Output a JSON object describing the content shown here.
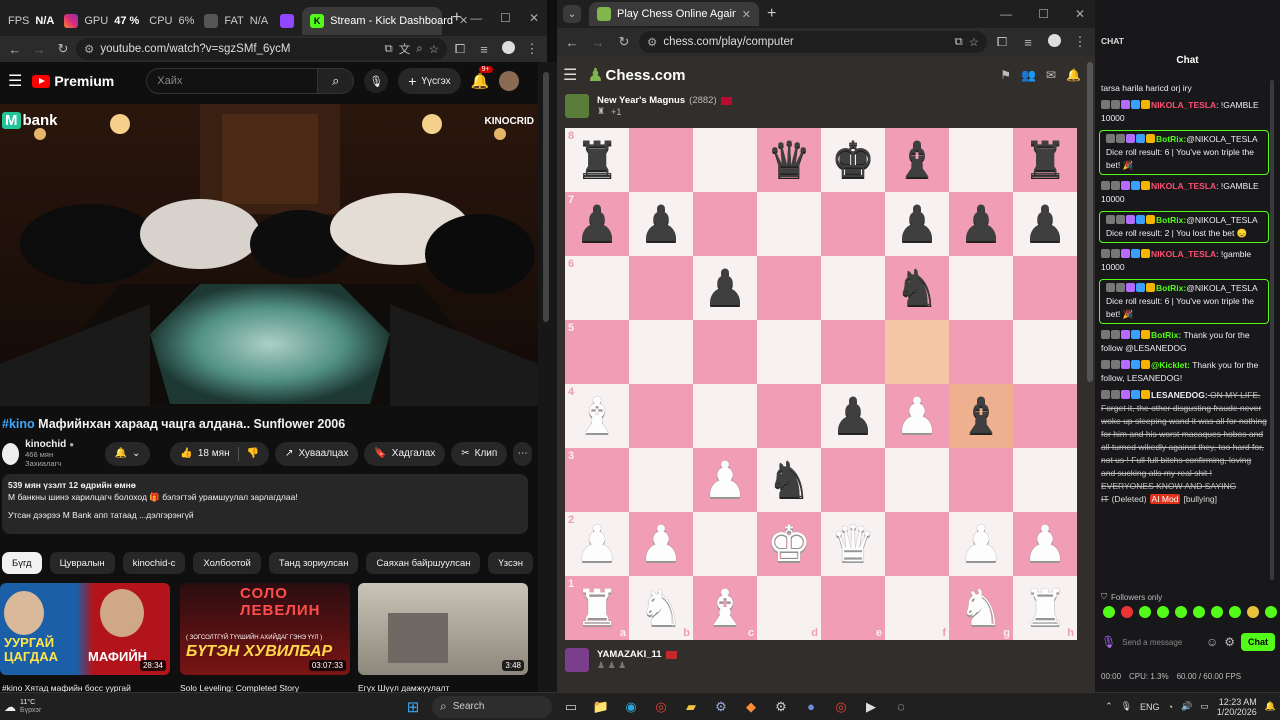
{
  "left_browser": {
    "tabs": [
      {
        "label": "FPS",
        "stat": "N/A"
      },
      {
        "label": "GPU",
        "stat": "47 %"
      },
      {
        "label": "CPU",
        "stat": "6%"
      },
      {
        "label": "FAT",
        "stat": "N/A"
      },
      {
        "label": ""
      },
      {
        "label": "Stream - Kick Dashboard"
      }
    ],
    "url": "youtube.com/watch?v=sgzSMf_6ycM"
  },
  "youtube": {
    "brand": "Premium",
    "search_placeholder": "Хайх",
    "create_label": "Үүсгэх",
    "notif_count": "9+",
    "video_overlay_left": "bank",
    "video_overlay_left_prefix": "M",
    "video_overlay_right": "KINOCRID",
    "hashtag": "#kino",
    "title": "Мафийнхан хараад чацга алдана.. Sunflower 2006",
    "channel": {
      "name": "kinochid",
      "subs": "466 мян Захиалагч"
    },
    "actions": {
      "likes": "18 мян",
      "share": "Хуваалцах",
      "save": "Хадгалах",
      "clip": "Клип"
    },
    "desc_line1": "539 мян үзэлт  12 өдрийн өмнө",
    "desc_line2": "М банкны шинэ харилцагч болоход 🎁 бэлэгтэй урамшуулал зарлагдлаа!",
    "desc_line3": "Утсан дээрээ M Bank апп татаад ...дэлгэрэнгүй",
    "chips": [
      "Бүгд",
      "Цувралын",
      "kinochid-с",
      "Холбоотой",
      "Танд зориулсан",
      "Саяхан байршуулсан",
      "Үзсэн"
    ],
    "thumbs": [
      {
        "title": "#kino Хятад мафийн босс уургай",
        "duration": "28:34",
        "text1": "УУРГАЙ",
        "text2": "ЦАГДАА",
        "text3": "МАФИЙН"
      },
      {
        "title": "Solo Leveling: Completed Story",
        "duration": "03:07:33",
        "text1": "СОЛО ЛЕВЕЛИН",
        "text2": "БҮТЭН ХУВИЛБАР",
        "text3": "( ЗОГСОЛТГҮЙ ТҮҮШИЙН АХИЙДАГ ГЭНЭ ҮҮЛ )"
      },
      {
        "title": "Егүх Шүүл дамжуулалт",
        "duration": "3:48"
      }
    ]
  },
  "chess_browser": {
    "tab_title": "Play Chess Online Against the C",
    "url": "chess.com/play/computer",
    "logo": "Chess.com",
    "opponent": {
      "name": "New Year's Magnus",
      "rating": "(2882)",
      "plus": "+1"
    },
    "player": {
      "name": "YAMAZAKI_11"
    },
    "ranks": [
      "8",
      "7",
      "6",
      "5",
      "4",
      "3",
      "2",
      "1"
    ],
    "files": [
      "a",
      "b",
      "c",
      "d",
      "e",
      "f",
      "g",
      "h"
    ],
    "board": [
      [
        "br",
        "",
        "",
        "bq",
        "bk",
        "bb",
        "",
        "br"
      ],
      [
        "bp",
        "bp",
        "",
        "",
        "",
        "bp",
        "bp",
        "bp"
      ],
      [
        "",
        "",
        "bp",
        "",
        "",
        "bn",
        "",
        ""
      ],
      [
        "",
        "",
        "",
        "",
        "",
        "",
        "",
        ""
      ],
      [
        "wb",
        "",
        "",
        "",
        "bp",
        "wp",
        "bb",
        ""
      ],
      [
        "",
        "",
        "wp",
        "bn",
        "",
        "",
        "",
        ""
      ],
      [
        "wp",
        "wp",
        "",
        "wk",
        "wq",
        "",
        "wp",
        "wp"
      ],
      [
        "wr",
        "wn",
        "wb",
        "",
        "",
        "",
        "wn",
        "wr"
      ]
    ],
    "highlights": {
      "f5": "hl",
      "g4": "hl2"
    }
  },
  "chat": {
    "header": "CHAT",
    "title": "Chat",
    "messages": [
      {
        "user": "",
        "text": "tarsa harila hariсd orj iry",
        "color": "#efeff1",
        "box": false
      },
      {
        "user": "NIKOLA_TESLA",
        "text": ": !GAMBLE 10000",
        "color": "#ff4f73",
        "box": false
      },
      {
        "user": "BotRix:",
        "text": "@NIKOLA_TESLA Dice roll result: 6 | You've won triple the bet! 🎉",
        "color": "#53fc18",
        "box": true
      },
      {
        "user": "NIKOLA_TESLA",
        "text": ": !GAMBLE 10000",
        "color": "#ff4f73",
        "box": false
      },
      {
        "user": "BotRix:",
        "text": "@NIKOLA_TESLA Dice roll result: 2 | You lost the bet 😞",
        "color": "#53fc18",
        "box": true
      },
      {
        "user": "NIKOLA_TESLA",
        "text": ": !gamble 10000",
        "color": "#ff4f73",
        "box": false
      },
      {
        "user": "BotRix:",
        "text": "@NIKOLA_TESLA Dice roll result: 6 | You've won triple the bet! 🎉",
        "color": "#53fc18",
        "box": true
      },
      {
        "user": "BotRix:",
        "text": " Thank you for the follow @LESANEDOG",
        "color": "#53fc18",
        "box": false
      },
      {
        "user": "@Kicklet:",
        "text": " Thank you for the follow, LESANEDOG!",
        "color": "#53fc18",
        "box": false
      },
      {
        "user": "LESANEDOG:",
        "text": " ON MY LIFE. Forget it, the other disgusting fraude never woke up sleeping wand it was all for nothing for him and his worst macaques hobos and all turned wikedly against they, too hard for, not us ! Full full bitchs confirming, loving and sucking alls my real shit ! EVERYONES KNOW AND SAYING IT",
        "color": "#efeff1",
        "box": false,
        "deleted": "(Deleted)",
        "mod": "AI Mod",
        "tag": "[bullying]"
      }
    ],
    "followers_only": "Followers only",
    "input_placeholder": "Send a message",
    "send_label": "Chat",
    "stats": {
      "time": "00:00",
      "cpu": "CPU: 1.3%",
      "fps": "60.00 / 60.00 FPS"
    }
  },
  "taskbar": {
    "weather_temp": "11°C",
    "weather_desc": "Бүрхэг",
    "search_placeholder": "Search",
    "lang": "ENG",
    "time": "12:23 AM",
    "date": "1/20/2026"
  }
}
